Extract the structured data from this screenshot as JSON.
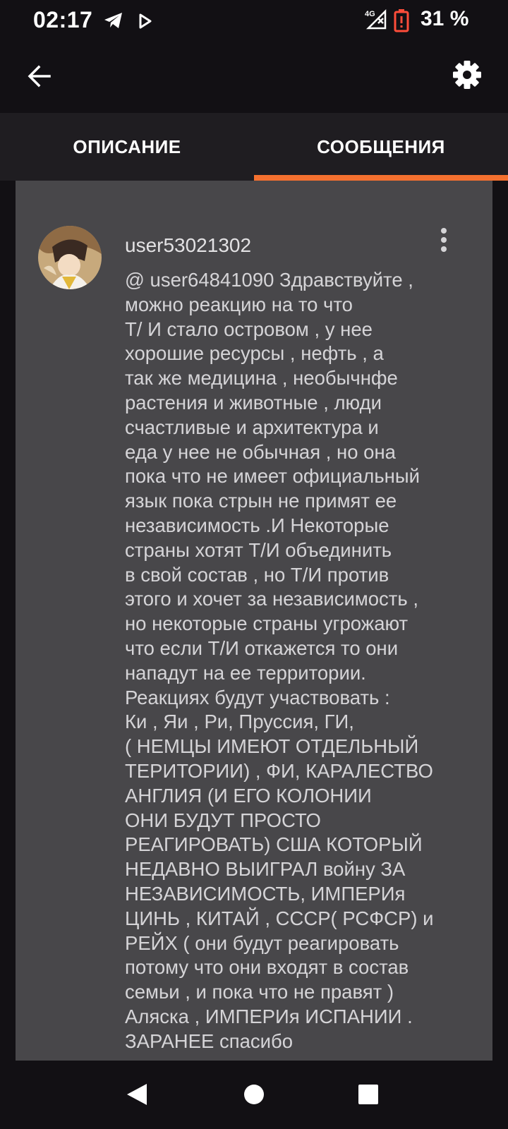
{
  "status_bar": {
    "time": "02:17",
    "left_icons": [
      "telegram-icon",
      "play-icon"
    ],
    "right_icons": [
      "signal-4g-icon",
      "battery-low-icon"
    ],
    "network_label": "4G",
    "battery_text": "31 %"
  },
  "app_bar": {
    "back_icon": "arrow-left-icon",
    "settings_icon": "gear-icon"
  },
  "tabs": [
    {
      "label": "ОПИСАНИЕ",
      "selected": false
    },
    {
      "label": "СООБЩЕНИЯ",
      "selected": true
    }
  ],
  "accent_color": "#f4702f",
  "comment": {
    "username": "user53021302",
    "more_icon": "more-vertical-icon",
    "lines": [
      "@ user64841090  Здравствуйте ,",
      "можно реакцию на то что",
      "Т/ И стало островом , у нее",
      "хорошие ресурсы , нефть , а",
      "так же медицина , необычнфе",
      "растения и животные , люди",
      "счастливые и архитектура  и",
      "еда у нее не обычная , но она",
      "пока что не имеет официальный",
      "язык пока стрын не примят ее",
      "независимость .И Некоторые",
      "страны хотят Т/И объединить",
      "в свой состав , но Т/И против",
      "этого и хочет за независимость ,",
      "но некоторые страны угрожают",
      "что если Т/И откажется то они",
      "нападут на ее территории.",
      "Реакциях будут участвовать :",
      "Ки , Яи , Ри, Пруссия, ГИ,",
      "( НЕМЦЫ ИМЕЮТ ОТДЕЛЬНЫЙ",
      "ТЕРИТОРИИ) , ФИ, КАРАЛЕСТВО",
      "АНГЛИЯ (И ЕГО КОЛОНИИ",
      "ОНИ БУДУТ ПРОСТО",
      "РЕАГИРОВАТЬ) США КОТОРЫЙ",
      "НЕДАВНО ВЫИГРАЛ войну ЗА",
      "НЕЗАВИСИМОСТЬ, ИМПЕРИя",
      "ЦИНЬ , КИТАЙ , СССР( РСФСР) и",
      "РЕЙХ ( они будут реагировать",
      "потому что они входят в состав",
      "семьи , и пока что не правят )",
      "Аляска , ИМПЕРИя ИСПАНИИ .",
      "ЗАРАНЕЕ спасибо"
    ]
  },
  "nav_bar": {
    "back_icon": "nav-back-triangle-icon",
    "home_icon": "nav-home-circle-icon",
    "recents_icon": "nav-recents-square-icon"
  }
}
